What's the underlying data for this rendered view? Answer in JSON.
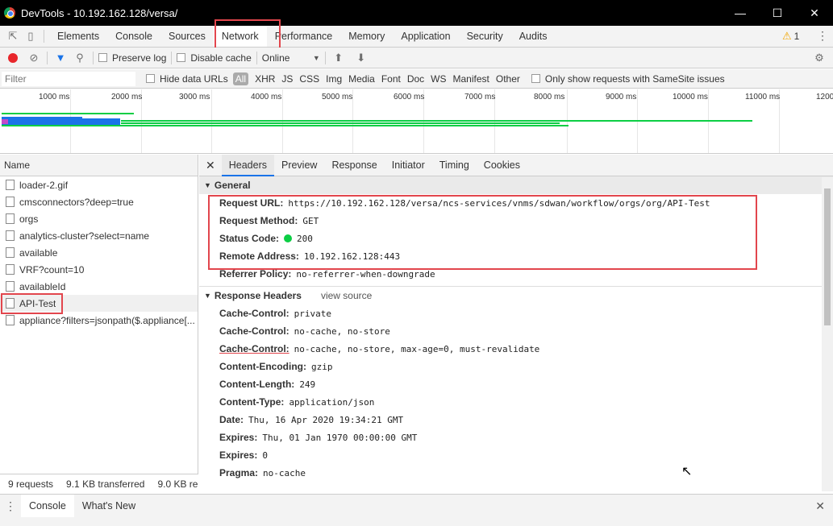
{
  "window": {
    "title": "DevTools - 10.192.162.128/versa/"
  },
  "devtools_tabs": [
    "Elements",
    "Console",
    "Sources",
    "Network",
    "Performance",
    "Memory",
    "Application",
    "Security",
    "Audits"
  ],
  "warning_count": "1",
  "toolbar": {
    "preserve_log": "Preserve log",
    "disable_cache": "Disable cache",
    "throttle": "Online"
  },
  "filter": {
    "placeholder": "Filter",
    "hide_data_urls": "Hide data URLs",
    "types": [
      "All",
      "XHR",
      "JS",
      "CSS",
      "Img",
      "Media",
      "Font",
      "Doc",
      "WS",
      "Manifest",
      "Other"
    ],
    "samesite": "Only show requests with SameSite issues"
  },
  "overview": {
    "ticks": [
      "1000 ms",
      "2000 ms",
      "3000 ms",
      "4000 ms",
      "5000 ms",
      "6000 ms",
      "7000 ms",
      "8000 ms",
      "9000 ms",
      "10000 ms",
      "11000 ms",
      "1200"
    ]
  },
  "requests": {
    "header": "Name",
    "items": [
      "loader-2.gif",
      "cmsconnectors?deep=true",
      "orgs",
      "analytics-cluster?select=name",
      "available",
      "VRF?count=10",
      "availableId",
      "API-Test",
      "appliance?filters=jsonpath($.appliance[..."
    ],
    "status": {
      "count": "9 requests",
      "transferred": "9.1 KB transferred",
      "resources": "9.0 KB re"
    }
  },
  "detail_tabs": [
    "Headers",
    "Preview",
    "Response",
    "Initiator",
    "Timing",
    "Cookies"
  ],
  "general": {
    "title": "General",
    "rows": [
      {
        "k": "Request URL:",
        "v": "https://10.192.162.128/versa/ncs-services/vnms/sdwan/workflow/orgs/org/API-Test"
      },
      {
        "k": "Request Method:",
        "v": "GET"
      },
      {
        "k": "Status Code:",
        "v": "200"
      },
      {
        "k": "Remote Address:",
        "v": "10.192.162.128:443"
      },
      {
        "k": "Referrer Policy:",
        "v": "no-referrer-when-downgrade"
      }
    ]
  },
  "response_headers": {
    "title": "Response Headers",
    "view_source": "view source",
    "rows": [
      {
        "k": "Cache-Control:",
        "v": "private"
      },
      {
        "k": "Cache-Control:",
        "v": "no-cache, no-store"
      },
      {
        "k": "Cache-Control:",
        "v": "no-cache, no-store, max-age=0, must-revalidate"
      },
      {
        "k": "Content-Encoding:",
        "v": "gzip"
      },
      {
        "k": "Content-Length:",
        "v": "249"
      },
      {
        "k": "Content-Type:",
        "v": "application/json"
      },
      {
        "k": "Date:",
        "v": "Thu, 16 Apr 2020 19:34:21 GMT"
      },
      {
        "k": "Expires:",
        "v": "Thu, 01 Jan 1970 00:00:00 GMT"
      },
      {
        "k": "Expires:",
        "v": "0"
      },
      {
        "k": "Pragma:",
        "v": "no-cache"
      }
    ]
  },
  "drawer": {
    "tabs": [
      "Console",
      "What's New"
    ]
  }
}
